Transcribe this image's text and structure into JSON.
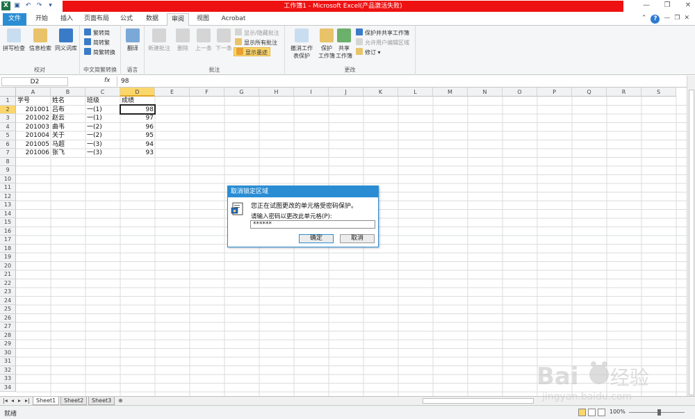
{
  "window": {
    "title": "工作簿1 - Microsoft Excel(产品激活失败)",
    "qat_icons": [
      "excel-logo-icon",
      "save-icon",
      "undo-icon",
      "redo-icon",
      "customize-qat-icon"
    ],
    "controls": [
      "minimize-icon",
      "restore-icon",
      "close-icon"
    ],
    "accent_color": "#ee1111"
  },
  "tabs": [
    {
      "label": "文件"
    },
    {
      "label": "开始"
    },
    {
      "label": "插入"
    },
    {
      "label": "页面布局"
    },
    {
      "label": "公式"
    },
    {
      "label": "数据"
    },
    {
      "label": "审阅"
    },
    {
      "label": "视图"
    },
    {
      "label": "Acrobat"
    }
  ],
  "active_tab": "审阅",
  "ribbon": {
    "groups": {
      "proofing": {
        "label": "校对",
        "buttons": [
          "拼写检查",
          "信息检索",
          "同义词库"
        ]
      },
      "chinese_conversion": {
        "label": "中文简繁转换",
        "buttons": [
          "繁转简",
          "简转繁",
          "简繁转换"
        ]
      },
      "language": {
        "label": "语言",
        "buttons": [
          "翻译"
        ]
      },
      "comments": {
        "label": "批注",
        "buttons": [
          "新建批注",
          "删除",
          "上一条",
          "下一条"
        ],
        "small": [
          "显示/隐藏批注",
          "显示所有批注",
          "显示墨迹"
        ]
      },
      "changes": {
        "label": "更改",
        "buttons": [
          {
            "line1": "撤消工作",
            "line2": "表保护"
          },
          {
            "line1": "保护",
            "line2": "工作簿"
          },
          {
            "line1": "共享",
            "line2": "工作簿"
          }
        ],
        "small": [
          "保护并共享工作簿",
          "允许用户编辑区域",
          "修订"
        ]
      }
    }
  },
  "formula_bar": {
    "name_box": "D2",
    "fx_label": "fx",
    "value": "98"
  },
  "columns": [
    "A",
    "B",
    "C",
    "D",
    "E",
    "F",
    "G",
    "H",
    "I",
    "J",
    "K",
    "L",
    "M",
    "N",
    "O",
    "P",
    "Q",
    "R",
    "S"
  ],
  "rows": [
    "1",
    "2",
    "3",
    "4",
    "5",
    "6",
    "7",
    "8",
    "9",
    "10",
    "11",
    "12",
    "13",
    "14",
    "15",
    "16",
    "17",
    "18",
    "19",
    "20",
    "21",
    "22",
    "23",
    "24",
    "25",
    "26",
    "27",
    "28",
    "29",
    "30",
    "31",
    "32",
    "33",
    "34"
  ],
  "sheet": {
    "headers": [
      "学号",
      "姓名",
      "班级",
      "成绩"
    ],
    "data": [
      [
        "201001",
        "吕布",
        "一(1)",
        "98"
      ],
      [
        "201002",
        "赵云",
        "一(1)",
        "97"
      ],
      [
        "201003",
        "曲韦",
        "一(2)",
        "96"
      ],
      [
        "201004",
        "关于",
        "一(2)",
        "95"
      ],
      [
        "201005",
        "马超",
        "一(3)",
        "94"
      ],
      [
        "201006",
        "张飞",
        "一(3)",
        "93"
      ]
    ]
  },
  "sheet_tabs": [
    "Sheet1",
    "Sheet2",
    "Sheet3"
  ],
  "status": {
    "ready": "就绪",
    "zoom": "100%"
  },
  "dialog": {
    "title": "取消锁定区域",
    "message": "您正在试图更改的单元格受密码保护。",
    "prompt": "请输入密码以更改此单元格(P):",
    "password_value": "******",
    "ok": "确定",
    "cancel": "取消"
  }
}
